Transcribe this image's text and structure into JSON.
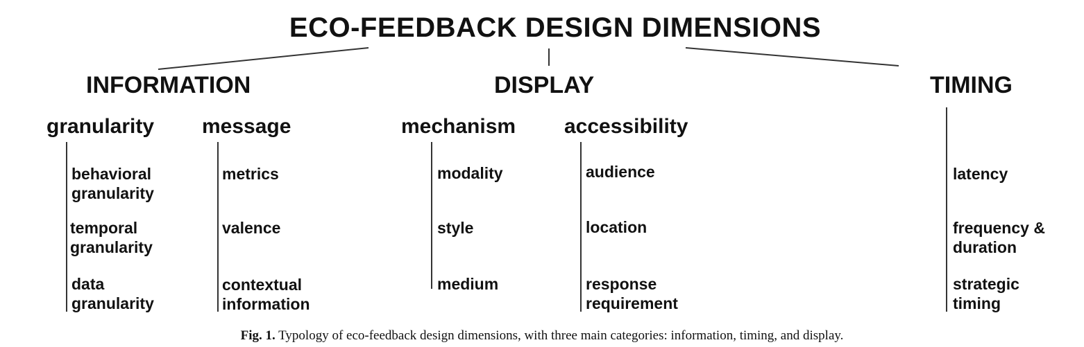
{
  "title": "ECO-FEEDBACK DESIGN DIMENSIONS",
  "categories": {
    "information": {
      "label": "INFORMATION",
      "granularity": {
        "label": "granularity",
        "items": [
          [
            "behavioral",
            "granularity"
          ],
          [
            "temporal",
            "granularity"
          ],
          [
            "data",
            "granularity"
          ]
        ]
      },
      "message": {
        "label": "message",
        "items": [
          [
            "metrics"
          ],
          [
            "valence"
          ],
          [
            "contextual",
            "information"
          ]
        ]
      }
    },
    "display": {
      "label": "DISPLAY",
      "mechanism": {
        "label": "mechanism",
        "items": [
          [
            "modality"
          ],
          [
            "style"
          ],
          [
            "medium"
          ]
        ]
      },
      "accessibility": {
        "label": "accessibility",
        "items": [
          [
            "audience"
          ],
          [
            "location"
          ],
          [
            "response",
            "requirement"
          ]
        ]
      }
    },
    "timing": {
      "label": "TIMING",
      "items": [
        [
          "latency"
        ],
        [
          "frequency &",
          "duration"
        ],
        [
          "strategic",
          "timing"
        ]
      ]
    }
  },
  "caption": {
    "label": "Fig. 1.",
    "text": "Typology of eco-feedback design dimensions, with three main categories: information, timing, and display."
  }
}
